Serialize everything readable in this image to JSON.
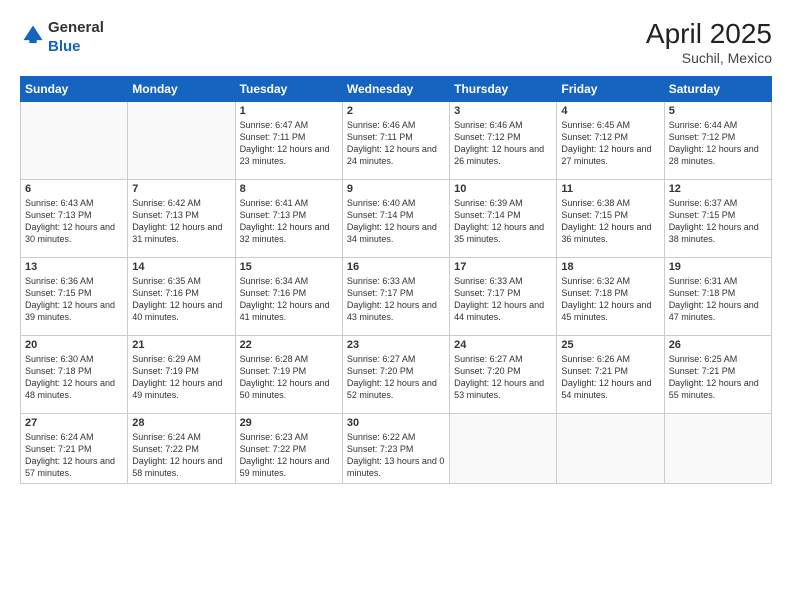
{
  "logo": {
    "general": "General",
    "blue": "Blue"
  },
  "title": "April 2025",
  "subtitle": "Suchil, Mexico",
  "weekdays": [
    "Sunday",
    "Monday",
    "Tuesday",
    "Wednesday",
    "Thursday",
    "Friday",
    "Saturday"
  ],
  "weeks": [
    [
      {
        "day": "",
        "info": ""
      },
      {
        "day": "",
        "info": ""
      },
      {
        "day": "1",
        "info": "Sunrise: 6:47 AM\nSunset: 7:11 PM\nDaylight: 12 hours and 23 minutes."
      },
      {
        "day": "2",
        "info": "Sunrise: 6:46 AM\nSunset: 7:11 PM\nDaylight: 12 hours and 24 minutes."
      },
      {
        "day": "3",
        "info": "Sunrise: 6:46 AM\nSunset: 7:12 PM\nDaylight: 12 hours and 26 minutes."
      },
      {
        "day": "4",
        "info": "Sunrise: 6:45 AM\nSunset: 7:12 PM\nDaylight: 12 hours and 27 minutes."
      },
      {
        "day": "5",
        "info": "Sunrise: 6:44 AM\nSunset: 7:12 PM\nDaylight: 12 hours and 28 minutes."
      }
    ],
    [
      {
        "day": "6",
        "info": "Sunrise: 6:43 AM\nSunset: 7:13 PM\nDaylight: 12 hours and 30 minutes."
      },
      {
        "day": "7",
        "info": "Sunrise: 6:42 AM\nSunset: 7:13 PM\nDaylight: 12 hours and 31 minutes."
      },
      {
        "day": "8",
        "info": "Sunrise: 6:41 AM\nSunset: 7:13 PM\nDaylight: 12 hours and 32 minutes."
      },
      {
        "day": "9",
        "info": "Sunrise: 6:40 AM\nSunset: 7:14 PM\nDaylight: 12 hours and 34 minutes."
      },
      {
        "day": "10",
        "info": "Sunrise: 6:39 AM\nSunset: 7:14 PM\nDaylight: 12 hours and 35 minutes."
      },
      {
        "day": "11",
        "info": "Sunrise: 6:38 AM\nSunset: 7:15 PM\nDaylight: 12 hours and 36 minutes."
      },
      {
        "day": "12",
        "info": "Sunrise: 6:37 AM\nSunset: 7:15 PM\nDaylight: 12 hours and 38 minutes."
      }
    ],
    [
      {
        "day": "13",
        "info": "Sunrise: 6:36 AM\nSunset: 7:15 PM\nDaylight: 12 hours and 39 minutes."
      },
      {
        "day": "14",
        "info": "Sunrise: 6:35 AM\nSunset: 7:16 PM\nDaylight: 12 hours and 40 minutes."
      },
      {
        "day": "15",
        "info": "Sunrise: 6:34 AM\nSunset: 7:16 PM\nDaylight: 12 hours and 41 minutes."
      },
      {
        "day": "16",
        "info": "Sunrise: 6:33 AM\nSunset: 7:17 PM\nDaylight: 12 hours and 43 minutes."
      },
      {
        "day": "17",
        "info": "Sunrise: 6:33 AM\nSunset: 7:17 PM\nDaylight: 12 hours and 44 minutes."
      },
      {
        "day": "18",
        "info": "Sunrise: 6:32 AM\nSunset: 7:18 PM\nDaylight: 12 hours and 45 minutes."
      },
      {
        "day": "19",
        "info": "Sunrise: 6:31 AM\nSunset: 7:18 PM\nDaylight: 12 hours and 47 minutes."
      }
    ],
    [
      {
        "day": "20",
        "info": "Sunrise: 6:30 AM\nSunset: 7:18 PM\nDaylight: 12 hours and 48 minutes."
      },
      {
        "day": "21",
        "info": "Sunrise: 6:29 AM\nSunset: 7:19 PM\nDaylight: 12 hours and 49 minutes."
      },
      {
        "day": "22",
        "info": "Sunrise: 6:28 AM\nSunset: 7:19 PM\nDaylight: 12 hours and 50 minutes."
      },
      {
        "day": "23",
        "info": "Sunrise: 6:27 AM\nSunset: 7:20 PM\nDaylight: 12 hours and 52 minutes."
      },
      {
        "day": "24",
        "info": "Sunrise: 6:27 AM\nSunset: 7:20 PM\nDaylight: 12 hours and 53 minutes."
      },
      {
        "day": "25",
        "info": "Sunrise: 6:26 AM\nSunset: 7:21 PM\nDaylight: 12 hours and 54 minutes."
      },
      {
        "day": "26",
        "info": "Sunrise: 6:25 AM\nSunset: 7:21 PM\nDaylight: 12 hours and 55 minutes."
      }
    ],
    [
      {
        "day": "27",
        "info": "Sunrise: 6:24 AM\nSunset: 7:21 PM\nDaylight: 12 hours and 57 minutes."
      },
      {
        "day": "28",
        "info": "Sunrise: 6:24 AM\nSunset: 7:22 PM\nDaylight: 12 hours and 58 minutes."
      },
      {
        "day": "29",
        "info": "Sunrise: 6:23 AM\nSunset: 7:22 PM\nDaylight: 12 hours and 59 minutes."
      },
      {
        "day": "30",
        "info": "Sunrise: 6:22 AM\nSunset: 7:23 PM\nDaylight: 13 hours and 0 minutes."
      },
      {
        "day": "",
        "info": ""
      },
      {
        "day": "",
        "info": ""
      },
      {
        "day": "",
        "info": ""
      }
    ]
  ]
}
